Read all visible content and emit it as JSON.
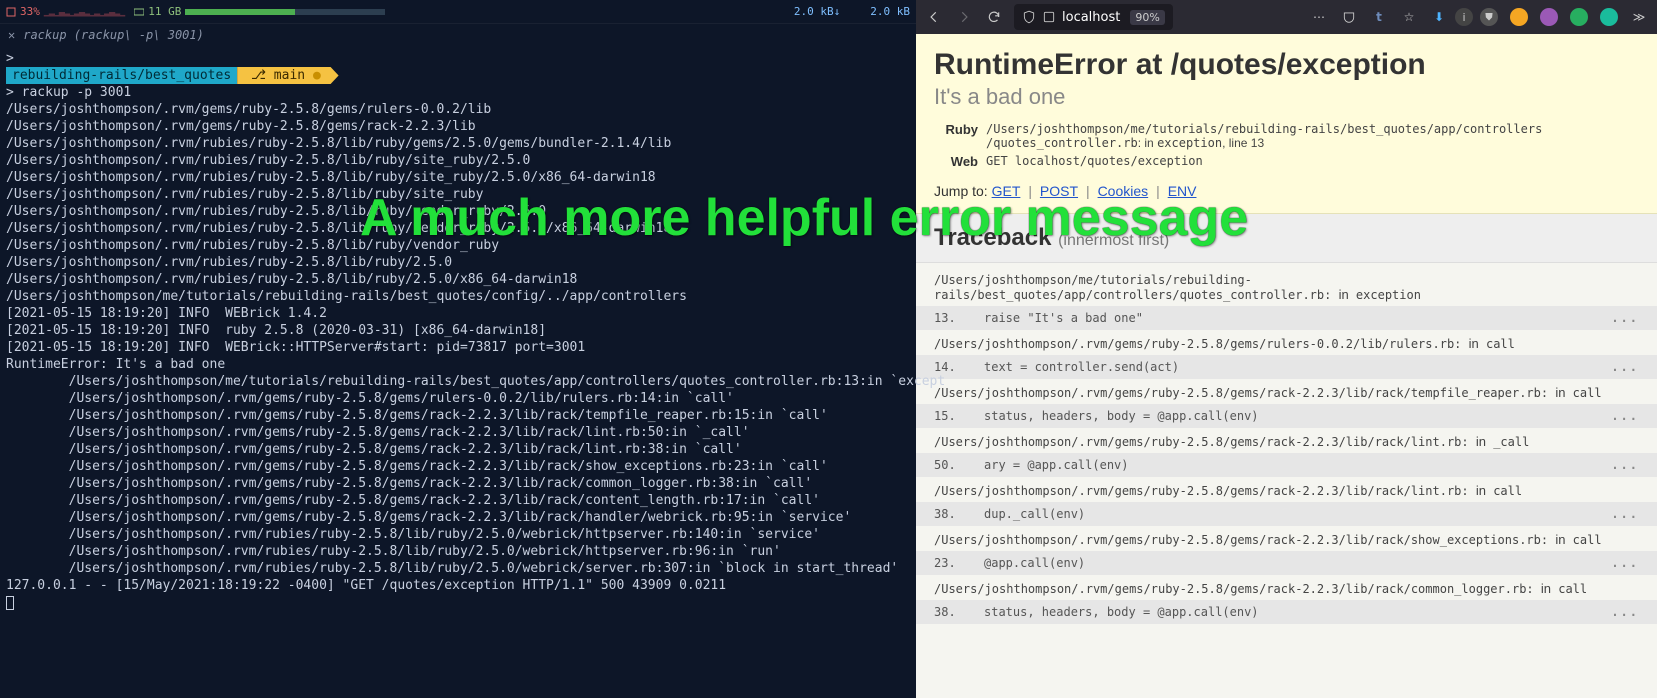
{
  "overlay": {
    "text": "A much more helpful error message"
  },
  "terminal": {
    "statusbar": {
      "cpu_pct": "33%",
      "mem": "11 GB",
      "net_down": "2.0 kB↓",
      "net_up": "2.0 kB"
    },
    "tab": {
      "close": "✕",
      "name": "rackup (rackup\\ -p\\ 3001)"
    },
    "prompt1": ">",
    "path_badge": "rebuilding-rails/best_quotes",
    "branch_icon": "⎇",
    "branch_name": "main",
    "branch_dot": "●",
    "command": "> rackup -p 3001",
    "lines": [
      "/Users/joshthompson/.rvm/gems/ruby-2.5.8/gems/rulers-0.0.2/lib",
      "/Users/joshthompson/.rvm/gems/ruby-2.5.8/gems/rack-2.2.3/lib",
      "/Users/joshthompson/.rvm/rubies/ruby-2.5.8/lib/ruby/gems/2.5.0/gems/bundler-2.1.4/lib",
      "/Users/joshthompson/.rvm/rubies/ruby-2.5.8/lib/ruby/site_ruby/2.5.0",
      "/Users/joshthompson/.rvm/rubies/ruby-2.5.8/lib/ruby/site_ruby/2.5.0/x86_64-darwin18",
      "/Users/joshthompson/.rvm/rubies/ruby-2.5.8/lib/ruby/site_ruby",
      "/Users/joshthompson/.rvm/rubies/ruby-2.5.8/lib/ruby/vendor_ruby/2.5.0",
      "/Users/joshthompson/.rvm/rubies/ruby-2.5.8/lib/ruby/vendor_ruby/2.5.0/x86_64-darwin18",
      "/Users/joshthompson/.rvm/rubies/ruby-2.5.8/lib/ruby/vendor_ruby",
      "/Users/joshthompson/.rvm/rubies/ruby-2.5.8/lib/ruby/2.5.0",
      "/Users/joshthompson/.rvm/rubies/ruby-2.5.8/lib/ruby/2.5.0/x86_64-darwin18",
      "/Users/joshthompson/me/tutorials/rebuilding-rails/best_quotes/config/../app/controllers",
      "[2021-05-15 18:19:20] INFO  WEBrick 1.4.2",
      "[2021-05-15 18:19:20] INFO  ruby 2.5.8 (2020-03-31) [x86_64-darwin18]",
      "[2021-05-15 18:19:20] INFO  WEBrick::HTTPServer#start: pid=73817 port=3001",
      "RuntimeError: It's a bad one",
      "        /Users/joshthompson/me/tutorials/rebuilding-rails/best_quotes/app/controllers/quotes_controller.rb:13:in `except",
      "        /Users/joshthompson/.rvm/gems/ruby-2.5.8/gems/rulers-0.0.2/lib/rulers.rb:14:in `call'",
      "        /Users/joshthompson/.rvm/gems/ruby-2.5.8/gems/rack-2.2.3/lib/rack/tempfile_reaper.rb:15:in `call'",
      "        /Users/joshthompson/.rvm/gems/ruby-2.5.8/gems/rack-2.2.3/lib/rack/lint.rb:50:in `_call'",
      "        /Users/joshthompson/.rvm/gems/ruby-2.5.8/gems/rack-2.2.3/lib/rack/lint.rb:38:in `call'",
      "        /Users/joshthompson/.rvm/gems/ruby-2.5.8/gems/rack-2.2.3/lib/rack/show_exceptions.rb:23:in `call'",
      "        /Users/joshthompson/.rvm/gems/ruby-2.5.8/gems/rack-2.2.3/lib/rack/common_logger.rb:38:in `call'",
      "        /Users/joshthompson/.rvm/gems/ruby-2.5.8/gems/rack-2.2.3/lib/rack/content_length.rb:17:in `call'",
      "        /Users/joshthompson/.rvm/gems/ruby-2.5.8/gems/rack-2.2.3/lib/rack/handler/webrick.rb:95:in `service'",
      "        /Users/joshthompson/.rvm/rubies/ruby-2.5.8/lib/ruby/2.5.0/webrick/httpserver.rb:140:in `service'",
      "        /Users/joshthompson/.rvm/rubies/ruby-2.5.8/lib/ruby/2.5.0/webrick/httpserver.rb:96:in `run'",
      "        /Users/joshthompson/.rvm/rubies/ruby-2.5.8/lib/ruby/2.5.0/webrick/server.rb:307:in `block in start_thread'",
      "127.0.0.1 - - [15/May/2021:18:19:22 -0400] \"GET /quotes/exception HTTP/1.1\" 500 43909 0.0211"
    ]
  },
  "browser": {
    "toolbar": {
      "url": "localhost",
      "zoom": "90%"
    },
    "error": {
      "title": "RuntimeError at /quotes/exception",
      "subtitle": "It's a bad one",
      "ruby_label": "Ruby",
      "ruby_val_1": "/Users/joshthompson/me/tutorials/rebuilding-rails/best_quotes/app/controllers",
      "ruby_val_2a": "/quotes_controller.rb",
      "ruby_in": ": in ",
      "ruby_method": "exception",
      "ruby_line": ", line 13",
      "web_label": "Web",
      "web_val": "GET localhost/quotes/exception",
      "link_jump": "Jump to:",
      "link_get": "GET",
      "link_post": "POST",
      "link_cookies": "Cookies",
      "link_env": "ENV"
    },
    "traceback": {
      "heading": "Traceback",
      "inner": "(innermost first)",
      "frames": [
        {
          "loc": "/Users/joshthompson/me/tutorials/rebuilding-rails/best_quotes/app/controllers/quotes_controller.rb",
          "method": "exception",
          "lineno": "13.",
          "code": "raise \"It's a bad one\""
        },
        {
          "loc": "/Users/joshthompson/.rvm/gems/ruby-2.5.8/gems/rulers-0.0.2/lib/rulers.rb",
          "method": "call",
          "lineno": "14.",
          "code": "text = controller.send(act)"
        },
        {
          "loc": "/Users/joshthompson/.rvm/gems/ruby-2.5.8/gems/rack-2.2.3/lib/rack/tempfile_reaper.rb",
          "method": "call",
          "lineno": "15.",
          "code": "status, headers, body = @app.call(env)"
        },
        {
          "loc": "/Users/joshthompson/.rvm/gems/ruby-2.5.8/gems/rack-2.2.3/lib/rack/lint.rb",
          "method": "_call",
          "lineno": "50.",
          "code": "ary = @app.call(env)"
        },
        {
          "loc": "/Users/joshthompson/.rvm/gems/ruby-2.5.8/gems/rack-2.2.3/lib/rack/lint.rb",
          "method": "call",
          "lineno": "38.",
          "code": "dup._call(env)"
        },
        {
          "loc": "/Users/joshthompson/.rvm/gems/ruby-2.5.8/gems/rack-2.2.3/lib/rack/show_exceptions.rb",
          "method": "call",
          "lineno": "23.",
          "code": "@app.call(env)"
        },
        {
          "loc": "/Users/joshthompson/.rvm/gems/ruby-2.5.8/gems/rack-2.2.3/lib/rack/common_logger.rb",
          "method": "call",
          "lineno": "38.",
          "code": "status, headers, body = @app.call(env)"
        }
      ]
    }
  }
}
